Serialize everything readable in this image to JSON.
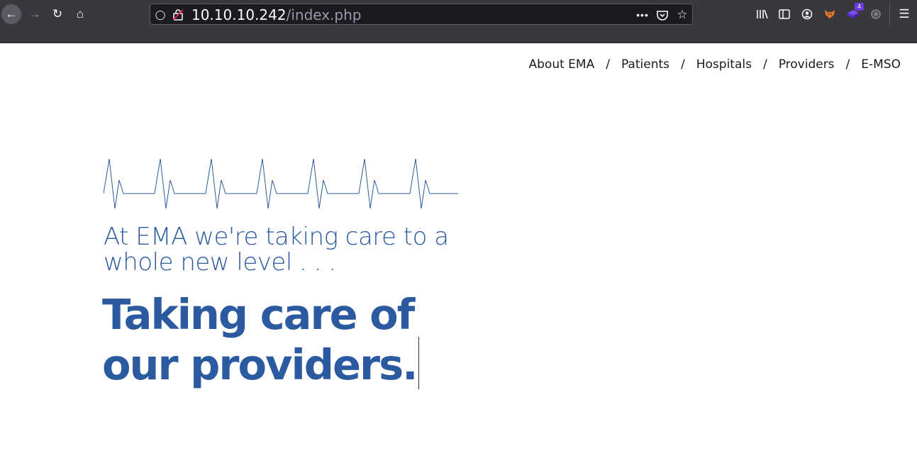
{
  "browser": {
    "url_host": "10.10.10.242",
    "url_path": "/index.php",
    "extension_badge": "4"
  },
  "nav": {
    "items": [
      "About EMA",
      "Patients",
      "Hospitals",
      "Providers",
      "E-MSO"
    ],
    "separator": "/"
  },
  "hero": {
    "tagline": "At EMA we're taking care to a whole new level . . .",
    "headline_line1": "Taking care of",
    "headline_line2": "our providers."
  },
  "colors": {
    "brand_blue": "#2c5aa0",
    "toolbar_bg": "#38383d",
    "urlbar_bg": "#1c1b22"
  }
}
